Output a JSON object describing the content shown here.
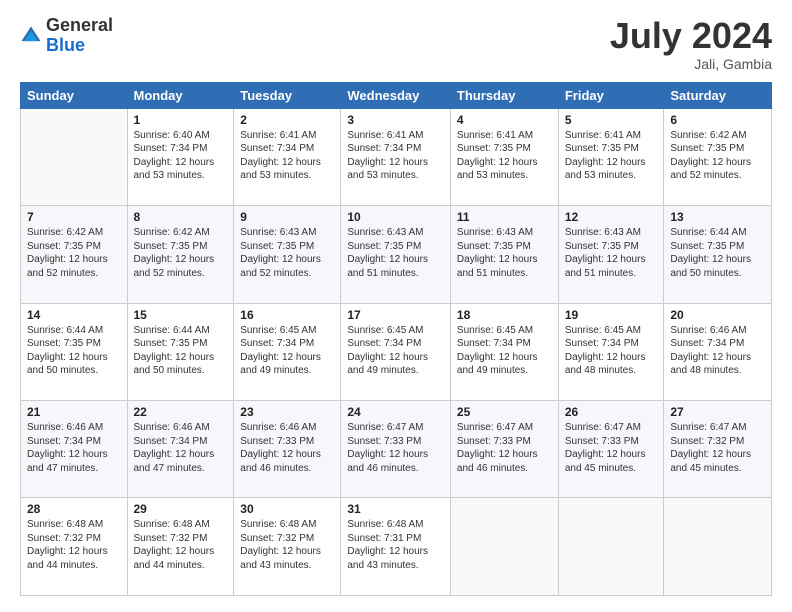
{
  "header": {
    "logo_general": "General",
    "logo_blue": "Blue",
    "month_title": "July 2024",
    "location": "Jali, Gambia"
  },
  "calendar": {
    "weekdays": [
      "Sunday",
      "Monday",
      "Tuesday",
      "Wednesday",
      "Thursday",
      "Friday",
      "Saturday"
    ],
    "weeks": [
      [
        {
          "day": "",
          "sunrise": "",
          "sunset": "",
          "daylight": ""
        },
        {
          "day": "1",
          "sunrise": "Sunrise: 6:40 AM",
          "sunset": "Sunset: 7:34 PM",
          "daylight": "Daylight: 12 hours and 53 minutes."
        },
        {
          "day": "2",
          "sunrise": "Sunrise: 6:41 AM",
          "sunset": "Sunset: 7:34 PM",
          "daylight": "Daylight: 12 hours and 53 minutes."
        },
        {
          "day": "3",
          "sunrise": "Sunrise: 6:41 AM",
          "sunset": "Sunset: 7:34 PM",
          "daylight": "Daylight: 12 hours and 53 minutes."
        },
        {
          "day": "4",
          "sunrise": "Sunrise: 6:41 AM",
          "sunset": "Sunset: 7:35 PM",
          "daylight": "Daylight: 12 hours and 53 minutes."
        },
        {
          "day": "5",
          "sunrise": "Sunrise: 6:41 AM",
          "sunset": "Sunset: 7:35 PM",
          "daylight": "Daylight: 12 hours and 53 minutes."
        },
        {
          "day": "6",
          "sunrise": "Sunrise: 6:42 AM",
          "sunset": "Sunset: 7:35 PM",
          "daylight": "Daylight: 12 hours and 52 minutes."
        }
      ],
      [
        {
          "day": "7",
          "sunrise": "Sunrise: 6:42 AM",
          "sunset": "Sunset: 7:35 PM",
          "daylight": "Daylight: 12 hours and 52 minutes."
        },
        {
          "day": "8",
          "sunrise": "Sunrise: 6:42 AM",
          "sunset": "Sunset: 7:35 PM",
          "daylight": "Daylight: 12 hours and 52 minutes."
        },
        {
          "day": "9",
          "sunrise": "Sunrise: 6:43 AM",
          "sunset": "Sunset: 7:35 PM",
          "daylight": "Daylight: 12 hours and 52 minutes."
        },
        {
          "day": "10",
          "sunrise": "Sunrise: 6:43 AM",
          "sunset": "Sunset: 7:35 PM",
          "daylight": "Daylight: 12 hours and 51 minutes."
        },
        {
          "day": "11",
          "sunrise": "Sunrise: 6:43 AM",
          "sunset": "Sunset: 7:35 PM",
          "daylight": "Daylight: 12 hours and 51 minutes."
        },
        {
          "day": "12",
          "sunrise": "Sunrise: 6:43 AM",
          "sunset": "Sunset: 7:35 PM",
          "daylight": "Daylight: 12 hours and 51 minutes."
        },
        {
          "day": "13",
          "sunrise": "Sunrise: 6:44 AM",
          "sunset": "Sunset: 7:35 PM",
          "daylight": "Daylight: 12 hours and 50 minutes."
        }
      ],
      [
        {
          "day": "14",
          "sunrise": "Sunrise: 6:44 AM",
          "sunset": "Sunset: 7:35 PM",
          "daylight": "Daylight: 12 hours and 50 minutes."
        },
        {
          "day": "15",
          "sunrise": "Sunrise: 6:44 AM",
          "sunset": "Sunset: 7:35 PM",
          "daylight": "Daylight: 12 hours and 50 minutes."
        },
        {
          "day": "16",
          "sunrise": "Sunrise: 6:45 AM",
          "sunset": "Sunset: 7:34 PM",
          "daylight": "Daylight: 12 hours and 49 minutes."
        },
        {
          "day": "17",
          "sunrise": "Sunrise: 6:45 AM",
          "sunset": "Sunset: 7:34 PM",
          "daylight": "Daylight: 12 hours and 49 minutes."
        },
        {
          "day": "18",
          "sunrise": "Sunrise: 6:45 AM",
          "sunset": "Sunset: 7:34 PM",
          "daylight": "Daylight: 12 hours and 49 minutes."
        },
        {
          "day": "19",
          "sunrise": "Sunrise: 6:45 AM",
          "sunset": "Sunset: 7:34 PM",
          "daylight": "Daylight: 12 hours and 48 minutes."
        },
        {
          "day": "20",
          "sunrise": "Sunrise: 6:46 AM",
          "sunset": "Sunset: 7:34 PM",
          "daylight": "Daylight: 12 hours and 48 minutes."
        }
      ],
      [
        {
          "day": "21",
          "sunrise": "Sunrise: 6:46 AM",
          "sunset": "Sunset: 7:34 PM",
          "daylight": "Daylight: 12 hours and 47 minutes."
        },
        {
          "day": "22",
          "sunrise": "Sunrise: 6:46 AM",
          "sunset": "Sunset: 7:34 PM",
          "daylight": "Daylight: 12 hours and 47 minutes."
        },
        {
          "day": "23",
          "sunrise": "Sunrise: 6:46 AM",
          "sunset": "Sunset: 7:33 PM",
          "daylight": "Daylight: 12 hours and 46 minutes."
        },
        {
          "day": "24",
          "sunrise": "Sunrise: 6:47 AM",
          "sunset": "Sunset: 7:33 PM",
          "daylight": "Daylight: 12 hours and 46 minutes."
        },
        {
          "day": "25",
          "sunrise": "Sunrise: 6:47 AM",
          "sunset": "Sunset: 7:33 PM",
          "daylight": "Daylight: 12 hours and 46 minutes."
        },
        {
          "day": "26",
          "sunrise": "Sunrise: 6:47 AM",
          "sunset": "Sunset: 7:33 PM",
          "daylight": "Daylight: 12 hours and 45 minutes."
        },
        {
          "day": "27",
          "sunrise": "Sunrise: 6:47 AM",
          "sunset": "Sunset: 7:32 PM",
          "daylight": "Daylight: 12 hours and 45 minutes."
        }
      ],
      [
        {
          "day": "28",
          "sunrise": "Sunrise: 6:48 AM",
          "sunset": "Sunset: 7:32 PM",
          "daylight": "Daylight: 12 hours and 44 minutes."
        },
        {
          "day": "29",
          "sunrise": "Sunrise: 6:48 AM",
          "sunset": "Sunset: 7:32 PM",
          "daylight": "Daylight: 12 hours and 44 minutes."
        },
        {
          "day": "30",
          "sunrise": "Sunrise: 6:48 AM",
          "sunset": "Sunset: 7:32 PM",
          "daylight": "Daylight: 12 hours and 43 minutes."
        },
        {
          "day": "31",
          "sunrise": "Sunrise: 6:48 AM",
          "sunset": "Sunset: 7:31 PM",
          "daylight": "Daylight: 12 hours and 43 minutes."
        },
        {
          "day": "",
          "sunrise": "",
          "sunset": "",
          "daylight": ""
        },
        {
          "day": "",
          "sunrise": "",
          "sunset": "",
          "daylight": ""
        },
        {
          "day": "",
          "sunrise": "",
          "sunset": "",
          "daylight": ""
        }
      ]
    ]
  }
}
